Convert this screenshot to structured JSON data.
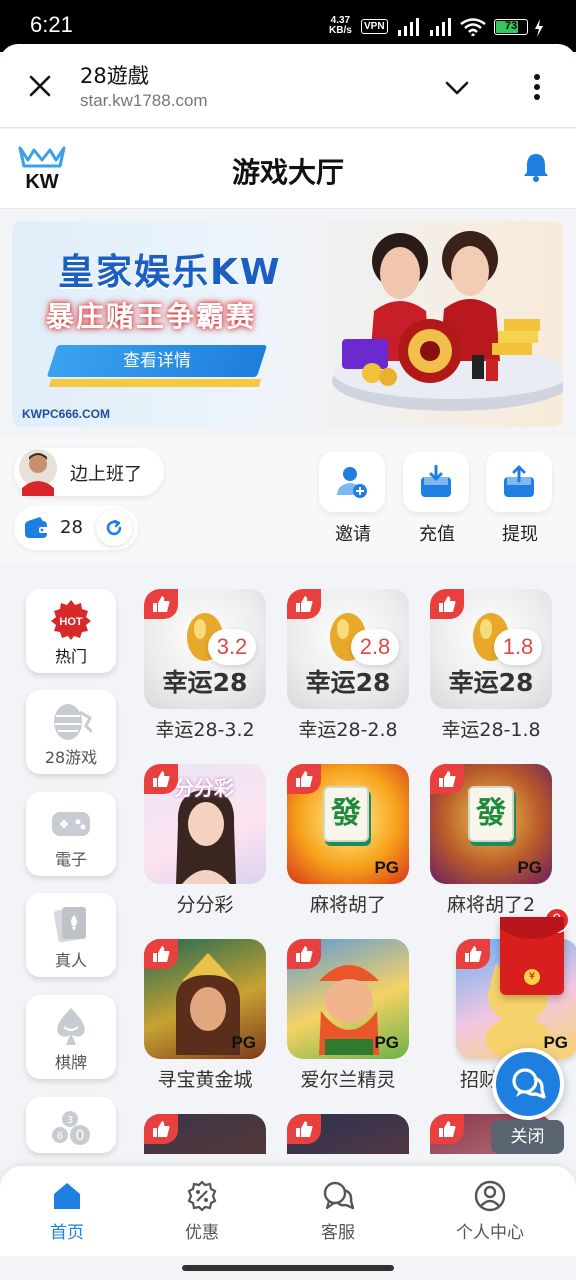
{
  "status_bar": {
    "time": "6:21",
    "speed_value": "4.37",
    "speed_unit": "KB/s",
    "vpn": "VPN",
    "battery": "73"
  },
  "browser": {
    "title": "28遊戲",
    "url": "star.kw1788.com"
  },
  "header": {
    "logo_text": "KW",
    "title": "游戏大厅"
  },
  "banner": {
    "title": "皇家娱乐KW",
    "subtitle": "暴庄赌王争霸赛",
    "button": "查看详情",
    "site": "KWPC666.COM"
  },
  "user": {
    "name": "边上班了",
    "balance": "28"
  },
  "actions": [
    {
      "label": "邀请"
    },
    {
      "label": "充值"
    },
    {
      "label": "提现"
    }
  ],
  "categories": [
    {
      "label": "热门",
      "badge": "HOT",
      "active": true
    },
    {
      "label": "28游戏"
    },
    {
      "label": "電子"
    },
    {
      "label": "真人"
    },
    {
      "label": "棋牌"
    }
  ],
  "games": [
    {
      "name": "幸运28-3.2",
      "thumb_title": "幸运28",
      "multiplier": "3.2"
    },
    {
      "name": "幸运28-2.8",
      "thumb_title": "幸运28",
      "multiplier": "2.8"
    },
    {
      "name": "幸运28-1.8",
      "thumb_title": "幸运28",
      "multiplier": "1.8"
    },
    {
      "name": "分分彩",
      "thumb_title": "分分彩"
    },
    {
      "name": "麻将胡了",
      "tag": "PG",
      "tile": "發"
    },
    {
      "name": "麻将胡了2",
      "tag": "PG",
      "tile": "發"
    },
    {
      "name": "寻宝黄金城",
      "tag": "PG"
    },
    {
      "name": "爱尔兰精灵",
      "tag": "PG"
    },
    {
      "name": "招财",
      "tag": "PG"
    }
  ],
  "floating": {
    "red_packet_count": "9",
    "red_packet_symbol": "¥",
    "close": "关闭"
  },
  "bottom_nav": [
    {
      "label": "首页",
      "active": true
    },
    {
      "label": "优惠"
    },
    {
      "label": "客服"
    },
    {
      "label": "个人中心"
    }
  ],
  "colors": {
    "primary": "#1e7fe0",
    "like": "#e8403e",
    "hot": "#d8282a",
    "red_packet": "#d91e1e"
  }
}
